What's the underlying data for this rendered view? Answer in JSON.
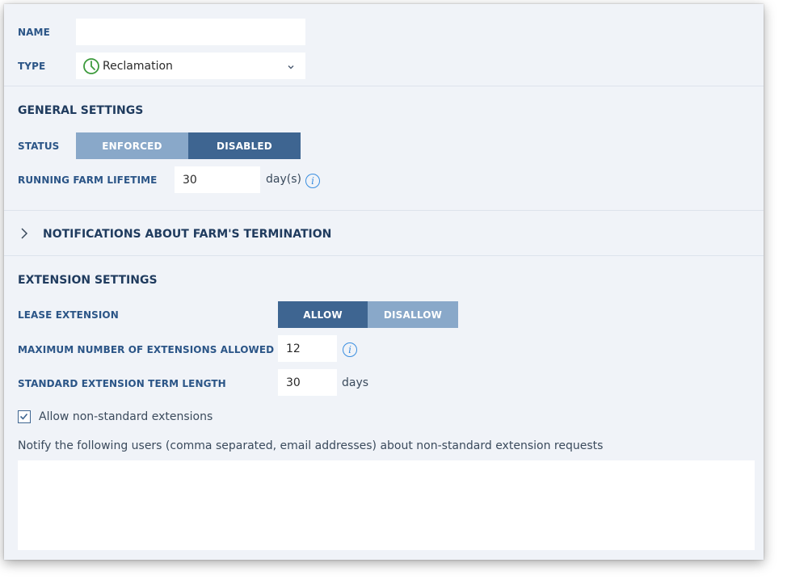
{
  "top": {
    "name_label": "NAME",
    "name_value": "",
    "type_label": "TYPE",
    "type_value": "Reclamation",
    "type_icon": "clock-icon"
  },
  "general": {
    "title": "GENERAL SETTINGS",
    "status_label": "STATUS",
    "status_options": [
      "ENFORCED",
      "DISABLED"
    ],
    "status_selected": "DISABLED",
    "lifetime_label": "RUNNING FARM LIFETIME",
    "lifetime_value": "30",
    "lifetime_unit": "day(s)"
  },
  "notifications": {
    "title": "NOTIFICATIONS ABOUT FARM'S TERMINATION"
  },
  "extension": {
    "title": "EXTENSION SETTINGS",
    "lease_label": "LEASE EXTENSION",
    "lease_options": [
      "ALLOW",
      "DISALLOW"
    ],
    "lease_selected": "ALLOW",
    "max_label": "MAXIMUM NUMBER OF EXTENSIONS ALLOWED",
    "max_value": "12",
    "term_label": "STANDARD EXTENSION TERM LENGTH",
    "term_value": "30",
    "term_unit": "days",
    "nonstandard_label": "Allow non-standard extensions",
    "nonstandard_checked": true,
    "notify_text": "Notify the following users (comma separated, email addresses) about non-standard extension requests",
    "notify_value": ""
  },
  "colors": {
    "panel_bg": "#f0f3f8",
    "label": "#2b5587",
    "segment_active": "#3e6591",
    "segment_inactive": "#89a8c9",
    "info": "#3a8ee0",
    "clock_icon": "#3c9a3c"
  }
}
